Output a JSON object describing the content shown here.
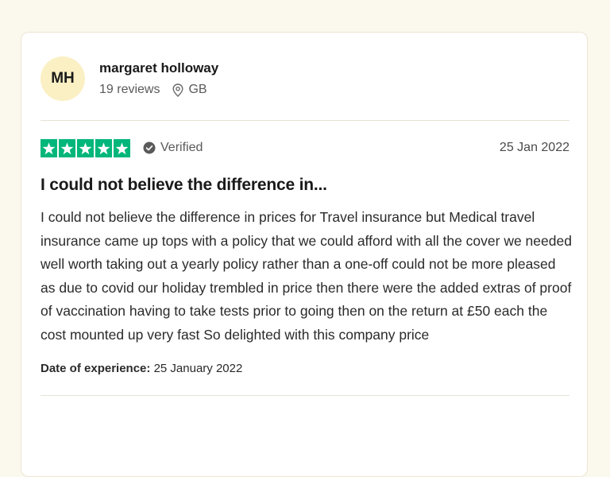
{
  "reviewer": {
    "initials": "MH",
    "name": "margaret holloway",
    "reviews": "19 reviews",
    "country": "GB",
    "avatar_color": "#fbf0c4"
  },
  "review": {
    "rating": 5,
    "max_rating": 5,
    "star_color": "#00b67a",
    "verified_label": "Verified",
    "date": "25 Jan 2022",
    "title": "I could not believe the difference in...",
    "body": "I could not believe the difference in prices for Travel insurance but Medical travel insurance came up tops with a policy that we could afford with all the cover we needed well worth taking out a yearly policy rather than a one-off could not be more pleased as due to covid our holiday trembled in price then there were the added extras of proof of vaccination having to take tests prior to going then on the return at £50 each the cost mounted up very fast So delighted with this company price",
    "experience_label": "Date of experience:",
    "experience_date": "25 January 2022"
  },
  "icons": {
    "location": "location-pin-icon",
    "verified": "verified-check-icon",
    "star": "star-icon"
  }
}
